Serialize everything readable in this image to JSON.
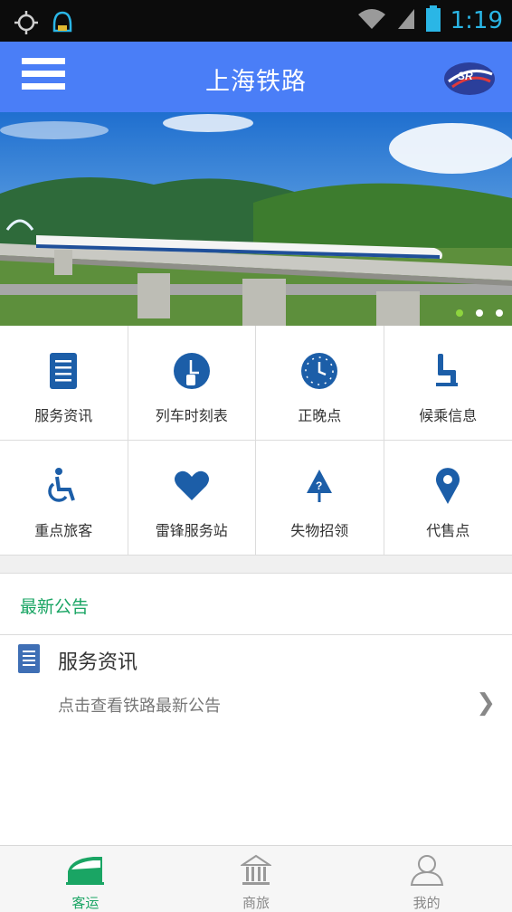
{
  "status_bar": {
    "time": "1:19",
    "icons": [
      "gps-icon",
      "notification-icon",
      "wifi-icon",
      "signal-icon",
      "battery-icon"
    ]
  },
  "app_bar": {
    "title": "上海铁路",
    "menu_icon": "menu-icon",
    "logo_text": "SR"
  },
  "banner": {
    "slides": 3,
    "active_slide": 1
  },
  "grid": {
    "items": [
      {
        "label": "服务资讯",
        "icon": "document-icon"
      },
      {
        "label": "列车时刻表",
        "icon": "clock-tablet-icon"
      },
      {
        "label": "正晚点",
        "icon": "clock-icon"
      },
      {
        "label": "候乘信息",
        "icon": "seat-icon"
      },
      {
        "label": "重点旅客",
        "icon": "wheelchair-icon"
      },
      {
        "label": "雷锋服务站",
        "icon": "heart-icon"
      },
      {
        "label": "失物招领",
        "icon": "lost-found-icon"
      },
      {
        "label": "代售点",
        "icon": "location-pin-icon"
      }
    ]
  },
  "notices": {
    "heading": "最新公告",
    "item": {
      "title": "服务资讯",
      "subtitle": "点击查看铁路最新公告",
      "chevron": "❯"
    }
  },
  "bottom_nav": {
    "items": [
      {
        "label": "客运",
        "icon": "train-icon",
        "active": true
      },
      {
        "label": "商旅",
        "icon": "building-icon",
        "active": false
      },
      {
        "label": "我的",
        "icon": "person-icon",
        "active": false
      }
    ]
  },
  "colors": {
    "app_bar": "#4a7ef7",
    "accent_green": "#1aa564",
    "icon_blue": "#1c5ea8"
  }
}
